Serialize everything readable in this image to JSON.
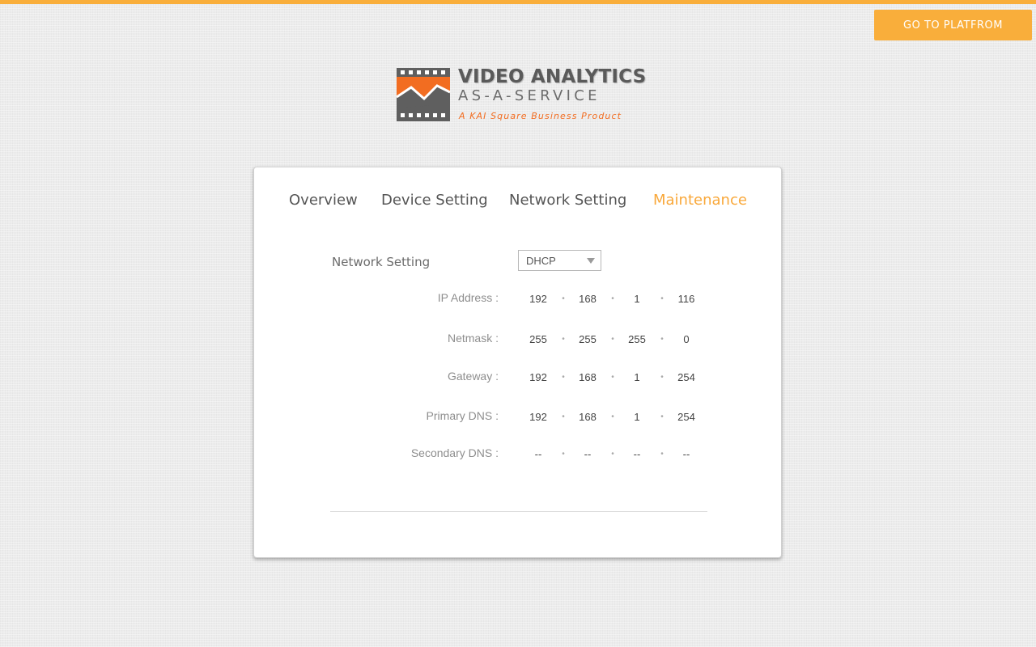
{
  "header": {
    "platform_button": "GO TO PLATFROM"
  },
  "logo": {
    "line1": "VIDEO ANALYTICS",
    "line2": "AS-A-SERVICE",
    "tagline": "A KAI Square Business Product",
    "colors": {
      "accent": "#f26d21",
      "gray": "#5a5a5a"
    }
  },
  "tabs": [
    {
      "label": "Overview",
      "active": false
    },
    {
      "label": "Device Setting",
      "active": false
    },
    {
      "label": "Network Setting",
      "active": false
    },
    {
      "label": "Maintenance",
      "active": true
    }
  ],
  "network": {
    "section_label": "Network Setting",
    "mode": {
      "selected": "DHCP"
    },
    "rows": [
      {
        "label": "IP Address :",
        "octets": [
          "192",
          "168",
          "1",
          "116"
        ]
      },
      {
        "label": "Netmask :",
        "octets": [
          "255",
          "255",
          "255",
          "0"
        ]
      },
      {
        "label": "Gateway :",
        "octets": [
          "192",
          "168",
          "1",
          "254"
        ]
      },
      {
        "label": "Primary DNS :",
        "octets": [
          "192",
          "168",
          "1",
          "254"
        ]
      },
      {
        "label": "Secondary DNS :",
        "octets": [
          "--",
          "--",
          "--",
          "--"
        ]
      }
    ],
    "separator": "•"
  },
  "colors": {
    "accent": "#f9ae3b",
    "active_tab": "#f9a83a",
    "text": "#555555",
    "label": "#8e8e8e"
  }
}
